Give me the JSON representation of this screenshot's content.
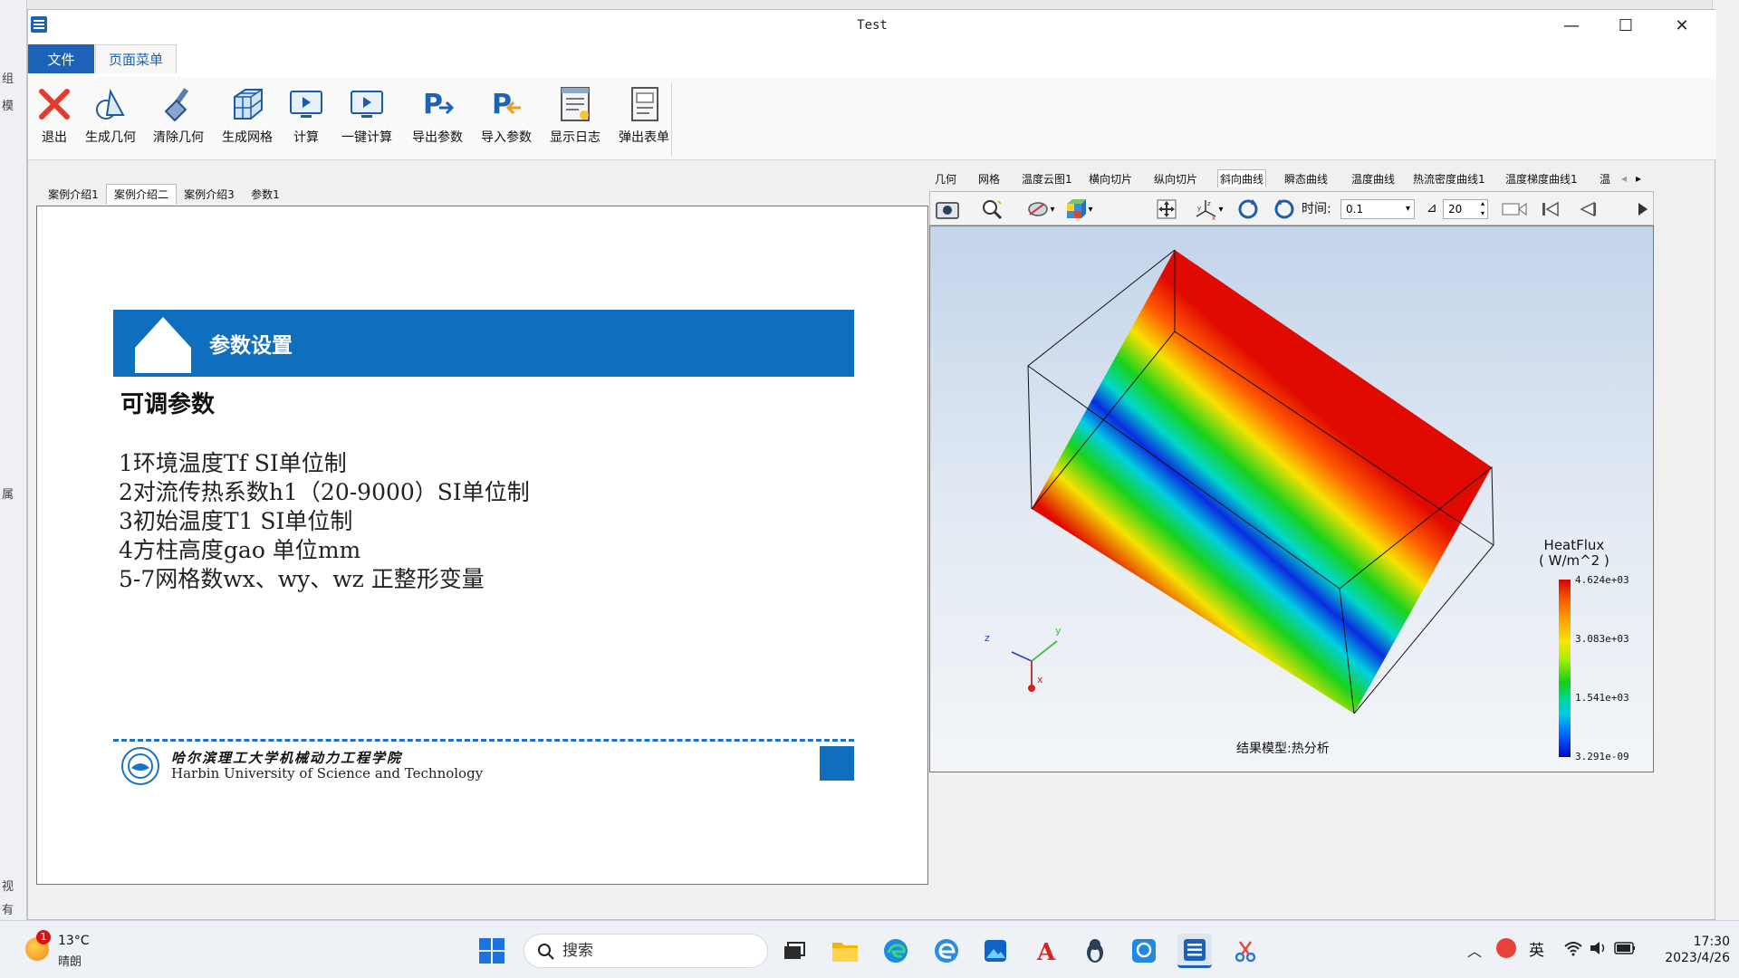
{
  "window": {
    "title": "Test",
    "minimize": "—",
    "maximize": "☐",
    "close": "✕"
  },
  "background": {
    "left_fragments": [
      "组",
      "模",
      "属",
      "视",
      "有"
    ]
  },
  "menu": {
    "file": "文件",
    "page_menu": "页面菜单"
  },
  "ribbon": [
    {
      "label": "退出",
      "icon": "exit-icon"
    },
    {
      "label": "生成几何",
      "icon": "geometry-icon"
    },
    {
      "label": "清除几何",
      "icon": "clear-icon"
    },
    {
      "label": "生成网格",
      "icon": "mesh-icon"
    },
    {
      "label": "计算",
      "icon": "compute-icon"
    },
    {
      "label": "一键计算",
      "icon": "one-click-icon"
    },
    {
      "label": "导出参数",
      "icon": "export-icon"
    },
    {
      "label": "导入参数",
      "icon": "import-icon"
    },
    {
      "label": "显示日志",
      "icon": "log-icon"
    },
    {
      "label": "弹出表单",
      "icon": "form-icon"
    }
  ],
  "left_tabs": [
    "案例介绍1",
    "案例介绍二",
    "案例介绍3",
    "参数1"
  ],
  "slide": {
    "title": "参数设置",
    "subtitle": "可调参数",
    "lines": [
      "1环境温度Tf  SI单位制",
      "2对流传热系数h1（20-9000）SI单位制",
      "3初始温度T1  SI单位制",
      "4方柱高度gao  单位mm",
      "5-7网格数wx、wy、wz 正整形变量"
    ],
    "school_cn": "哈尔滨理工大学机械动力工程学院",
    "school_en": "Harbin University of Science and Technology"
  },
  "right_tabs": [
    "几何",
    "网格",
    "温度云图1",
    "横向切片",
    "纵向切片",
    "斜向曲线",
    "瞬态曲线",
    "温度曲线",
    "热流密度曲线1",
    "温度梯度曲线1",
    "温"
  ],
  "viewer": {
    "time_label": "时间:",
    "time_value": "0.1",
    "step_value": "20",
    "result_label": "结果模型:热分析",
    "legend_title": "HeatFlux",
    "legend_unit": "( W/m^2 )",
    "legend_values": [
      "4.624e+03",
      "3.083e+03",
      "1.541e+03",
      "3.291e-09"
    ],
    "axes": {
      "x": "x",
      "y": "y",
      "z": "z"
    }
  },
  "taskbar": {
    "temperature": "13°C",
    "condition": "晴朗",
    "badge": "1",
    "search": "搜索",
    "ime": "英",
    "time": "17:30",
    "date": "2023/4/26"
  }
}
